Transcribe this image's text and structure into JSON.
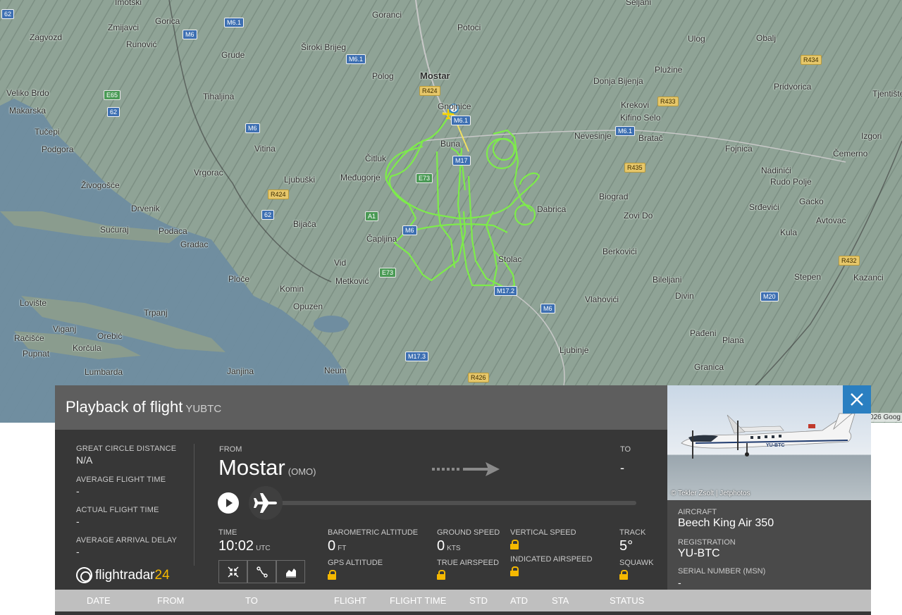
{
  "map": {
    "places": [
      {
        "name": "Imotski",
        "big": false
      },
      {
        "name": "Goranci",
        "big": false
      },
      {
        "name": "Seljani",
        "big": false
      },
      {
        "name": "Zagvozd",
        "big": false
      },
      {
        "name": "Zmijavci",
        "big": false
      },
      {
        "name": "Gorica",
        "big": false
      },
      {
        "name": "Runović",
        "big": false
      },
      {
        "name": "Potoci",
        "big": false
      },
      {
        "name": "Široki Brijeg",
        "big": false
      },
      {
        "name": "Ulog",
        "big": false
      },
      {
        "name": "Obalj",
        "big": false
      },
      {
        "name": "Grude",
        "big": false
      },
      {
        "name": "Mostar",
        "big": true
      },
      {
        "name": "Polog",
        "big": false
      },
      {
        "name": "Plužine",
        "big": false
      },
      {
        "name": "Veliko Brdo",
        "big": false
      },
      {
        "name": "Tihaljina",
        "big": false
      },
      {
        "name": "Donja Bijenja",
        "big": false
      },
      {
        "name": "Pridvorica",
        "big": false
      },
      {
        "name": "Makarska",
        "big": false
      },
      {
        "name": "Gnojnice",
        "big": false
      },
      {
        "name": "Krekovi",
        "big": false
      },
      {
        "name": "Kifino Selo",
        "big": false
      },
      {
        "name": "Tjentište",
        "big": false
      },
      {
        "name": "Tučepi",
        "big": false
      },
      {
        "name": "Buna",
        "big": false
      },
      {
        "name": "Nevesinje",
        "big": false
      },
      {
        "name": "Bratač",
        "big": false
      },
      {
        "name": "Izgori",
        "big": false
      },
      {
        "name": "Podgora",
        "big": false
      },
      {
        "name": "Vitina",
        "big": false
      },
      {
        "name": "Fojnica",
        "big": false
      },
      {
        "name": "Čitluk",
        "big": false
      },
      {
        "name": "Čemerno",
        "big": false
      },
      {
        "name": "Vrgorac",
        "big": false
      },
      {
        "name": "Ljubuški",
        "big": false
      },
      {
        "name": "Međugorje",
        "big": false
      },
      {
        "name": "Nadinići",
        "big": false
      },
      {
        "name": "Rudo Polje",
        "big": false
      },
      {
        "name": "Živogošće",
        "big": false
      },
      {
        "name": "Biograd",
        "big": false
      },
      {
        "name": "Gacko",
        "big": false
      },
      {
        "name": "Drvenik",
        "big": false
      },
      {
        "name": "Dabrica",
        "big": false
      },
      {
        "name": "Srđevići",
        "big": false
      },
      {
        "name": "Avtovac",
        "big": false
      },
      {
        "name": "Bijača",
        "big": false
      },
      {
        "name": "Zovi Do",
        "big": false
      },
      {
        "name": "Sućuraj",
        "big": false
      },
      {
        "name": "Podaca",
        "big": false
      },
      {
        "name": "Kula",
        "big": false
      },
      {
        "name": "Čapljina",
        "big": false
      },
      {
        "name": "Gradac",
        "big": false
      },
      {
        "name": "Berkovići",
        "big": false
      },
      {
        "name": "Stolac",
        "big": false
      },
      {
        "name": "Vid",
        "big": false
      },
      {
        "name": "Kazanci",
        "big": false
      },
      {
        "name": "Ploče",
        "big": false
      },
      {
        "name": "Metković",
        "big": false
      },
      {
        "name": "Stepen",
        "big": false
      },
      {
        "name": "Bileljani",
        "big": false
      },
      {
        "name": "Komin",
        "big": false
      },
      {
        "name": "Lovište",
        "big": false
      },
      {
        "name": "Vlahovići",
        "big": false
      },
      {
        "name": "Divin",
        "big": false
      },
      {
        "name": "Opuzen",
        "big": false
      },
      {
        "name": "Trpanj",
        "big": false
      },
      {
        "name": "Viganj",
        "big": false
      },
      {
        "name": "Pađeni",
        "big": false
      },
      {
        "name": "Orebić",
        "big": false
      },
      {
        "name": "Račišće",
        "big": false
      },
      {
        "name": "Plana",
        "big": false
      },
      {
        "name": "Korčula",
        "big": false
      },
      {
        "name": "Ljubinje",
        "big": false
      },
      {
        "name": "Pupnat",
        "big": false
      },
      {
        "name": "Granica",
        "big": false
      },
      {
        "name": "Lumbarda",
        "big": false
      },
      {
        "name": "Janjina",
        "big": false
      },
      {
        "name": "Neum",
        "big": false
      }
    ],
    "roads": [
      {
        "label": "M6.1",
        "kind": "m"
      },
      {
        "label": "M6",
        "kind": "m"
      },
      {
        "label": "M6.1",
        "kind": "m"
      },
      {
        "label": "R424",
        "kind": "r"
      },
      {
        "label": "R434",
        "kind": "r"
      },
      {
        "label": "E65",
        "kind": "e"
      },
      {
        "label": "62",
        "kind": "m"
      },
      {
        "label": "R433",
        "kind": "r"
      },
      {
        "label": "M6",
        "kind": "m"
      },
      {
        "label": "M6.1",
        "kind": "m"
      },
      {
        "label": "M6.1",
        "kind": "m"
      },
      {
        "label": "M17",
        "kind": "m"
      },
      {
        "label": "E73",
        "kind": "e"
      },
      {
        "label": "R435",
        "kind": "r"
      },
      {
        "label": "R424",
        "kind": "r"
      },
      {
        "label": "62",
        "kind": "m"
      },
      {
        "label": "A1",
        "kind": "e"
      },
      {
        "label": "M6",
        "kind": "m"
      },
      {
        "label": "E73",
        "kind": "e"
      },
      {
        "label": "R432",
        "kind": "r"
      },
      {
        "label": "M17.2",
        "kind": "m"
      },
      {
        "label": "M20",
        "kind": "m"
      },
      {
        "label": "M6",
        "kind": "m"
      },
      {
        "label": "M17.3",
        "kind": "m"
      },
      {
        "label": "R426",
        "kind": "r"
      },
      {
        "label": "62",
        "kind": "m"
      }
    ],
    "copyright": "2026 Goog"
  },
  "panel": {
    "title": "Playback of flight",
    "title_sub": "YUBTC",
    "stats": [
      {
        "label": "GREAT CIRCLE DISTANCE",
        "value": "N/A"
      },
      {
        "label": "AVERAGE FLIGHT TIME",
        "value": "-"
      },
      {
        "label": "ACTUAL FLIGHT TIME",
        "value": "-"
      },
      {
        "label": "AVERAGE ARRIVAL DELAY",
        "value": "-"
      }
    ],
    "logo": {
      "main": "flightradar",
      "accent": "24"
    },
    "route": {
      "from_label": "FROM",
      "from_city": "Mostar",
      "from_code": "(OMO)",
      "to_label": "TO",
      "to_value": "-"
    },
    "metrics": {
      "time_label": "TIME",
      "time_value": "10:02",
      "time_unit": "UTC",
      "baro_label": "BAROMETRIC ALTITUDE",
      "baro_value": "0",
      "baro_unit": "FT",
      "gps_label": "GPS ALTITUDE",
      "gs_label": "GROUND SPEED",
      "gs_value": "0",
      "gs_unit": "KTS",
      "tas_label": "TRUE AIRSPEED",
      "vs_label": "VERTICAL SPEED",
      "ias_label": "INDICATED AIRSPEED",
      "track_label": "TRACK",
      "track_value": "5°",
      "squawk_label": "SQUAWK"
    },
    "aircraft": {
      "photo_credit": "© Tekler Zsolt | Jetphotos",
      "photo_reg": "YU-BTC",
      "aircraft_label": "AIRCRAFT",
      "aircraft_value": "Beech King Air 350",
      "registration_label": "REGISTRATION",
      "registration_value": "YU-BTC",
      "serial_label": "SERIAL NUMBER (MSN)",
      "serial_value": "-"
    },
    "table_headers": [
      "DATE",
      "FROM",
      "TO",
      "FLIGHT",
      "FLIGHT TIME",
      "STD",
      "ATD",
      "STA",
      "STATUS"
    ]
  },
  "colors": {
    "track": "#7dec4a",
    "accent": "#2a7fc1",
    "lock": "#f5b800"
  }
}
